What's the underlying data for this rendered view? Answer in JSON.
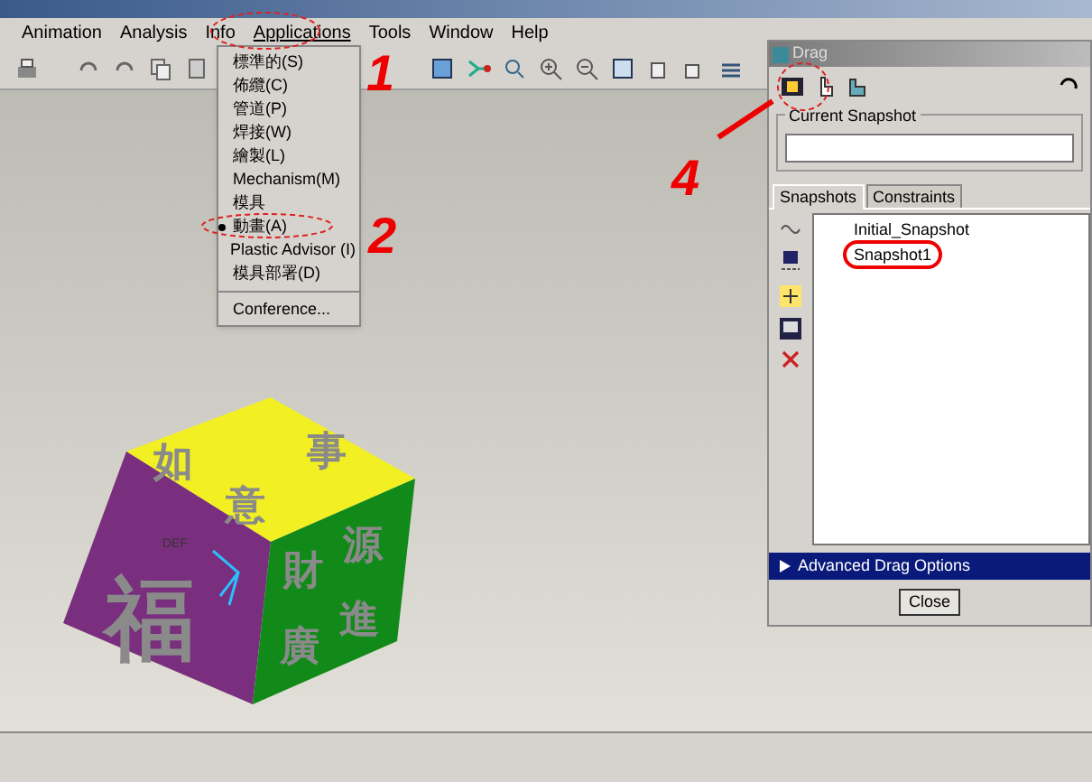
{
  "menubar": [
    {
      "label": "Animation",
      "selected": false
    },
    {
      "label": "Analysis",
      "selected": false
    },
    {
      "label": "Info",
      "selected": false
    },
    {
      "label": "Applications",
      "selected": true
    },
    {
      "label": "Tools",
      "selected": false
    },
    {
      "label": "Window",
      "selected": false
    },
    {
      "label": "Help",
      "selected": false
    }
  ],
  "applications_menu": [
    {
      "kind": "item",
      "label": "標準的(S)",
      "checked": false
    },
    {
      "kind": "item",
      "label": "佈纜(C)",
      "checked": false
    },
    {
      "kind": "item",
      "label": "管道(P)",
      "checked": false
    },
    {
      "kind": "item",
      "label": "焊接(W)",
      "checked": false
    },
    {
      "kind": "item",
      "label": "繪製(L)",
      "checked": false
    },
    {
      "kind": "item",
      "label": "Mechanism(M)",
      "checked": false
    },
    {
      "kind": "item",
      "label": "模具",
      "checked": false
    },
    {
      "kind": "item",
      "label": "動畫(A)",
      "checked": true
    },
    {
      "kind": "item",
      "label": "Plastic Advisor (I)",
      "checked": false
    },
    {
      "kind": "item",
      "label": "模具部署(D)",
      "checked": false
    },
    {
      "kind": "separator"
    },
    {
      "kind": "item",
      "label": "Conference...",
      "checked": false
    }
  ],
  "cube": {
    "left": [
      "福"
    ],
    "top": [
      "如",
      "意",
      "事"
    ],
    "right": [
      "財",
      "源",
      "廣",
      "進"
    ],
    "tag": "DEF"
  },
  "drag_dialog": {
    "title": "Drag",
    "current_snapshot": {
      "label": "Current Snapshot"
    },
    "tabs": [
      {
        "label": "Snapshots",
        "selected": true
      },
      {
        "label": "Constraints",
        "selected": false
      }
    ],
    "snapshots": [
      {
        "label": "Initial_Snapshot",
        "selected": false
      },
      {
        "label": "Snapshot1",
        "selected": true
      }
    ],
    "advanced": {
      "label": "Advanced Drag Options",
      "expanded": false
    },
    "close": "Close"
  },
  "annotations": [
    "1",
    "2",
    "4"
  ]
}
